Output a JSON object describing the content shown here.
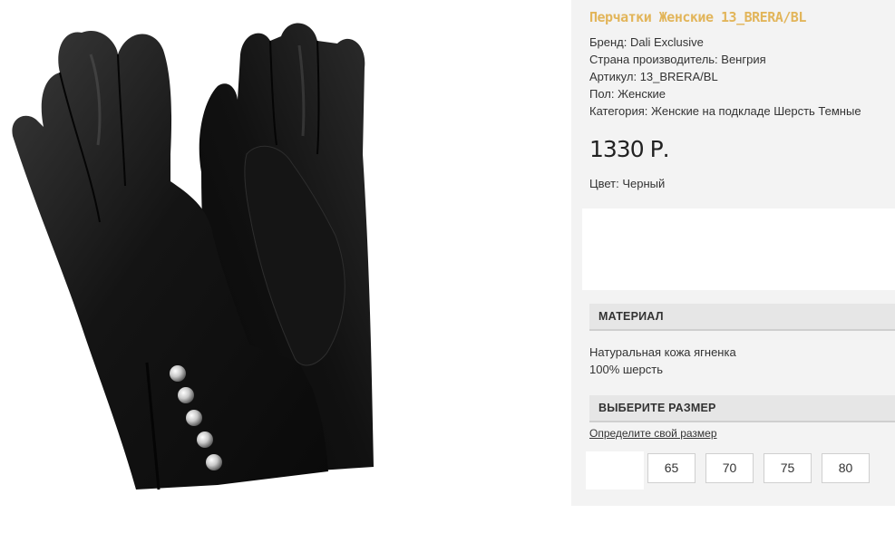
{
  "product": {
    "title": "Перчатки Женские 13_BRERA/BL",
    "brand": "Бренд: Dali Exclusive",
    "country": "Страна производитель: Венгрия",
    "article": "Артикул: 13_BRERA/BL",
    "gender": "Пол: Женские",
    "category": "Категория: Женские на подкладе Шерсть Темные",
    "price": "1330 Р.",
    "color": "Цвет: Черный"
  },
  "material": {
    "header": "МАТЕРИАЛ",
    "line1": "Натуральная кожа ягненка",
    "line2": "100% шерсть"
  },
  "size": {
    "header": "ВЫБЕРИТЕ РАЗМЕР",
    "link": "Определите свой размер",
    "options": [
      "65",
      "70",
      "75",
      "80"
    ]
  },
  "colors": {
    "title": "#e2b55a",
    "panel_bg": "#f3f3f3",
    "header_bg": "#e6e6e6"
  }
}
